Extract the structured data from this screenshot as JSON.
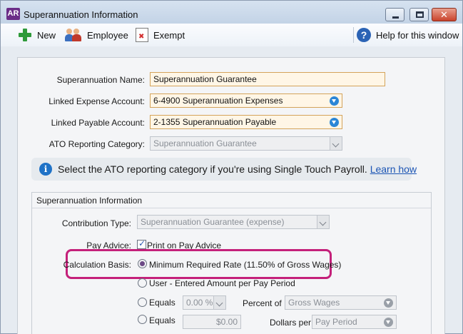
{
  "window": {
    "logo": "AR",
    "title": "Superannuation Information",
    "close_glyph": "✕"
  },
  "toolbar": {
    "new_label": "New",
    "employee_label": "Employee",
    "exempt_label": "Exempt",
    "help_label": "Help for this window",
    "help_glyph": "?"
  },
  "form": {
    "name_label": "Superannuation Name:",
    "name_value": "Superannuation Guarantee",
    "expense_label": "Linked Expense Account:",
    "expense_value": "6-4900 Superannuation Expenses",
    "payable_label": "Linked Payable Account:",
    "payable_value": "2-1355 Superannuation Payable",
    "ato_label": "ATO Reporting Category:",
    "ato_value": "Superannuation Guarantee"
  },
  "info": {
    "icon": "i",
    "text": "Select the ATO reporting category if you're using Single Touch Payroll.",
    "link": "Learn how"
  },
  "super_info": {
    "group_title": "Superannuation Information",
    "contribution_label": "Contribution Type:",
    "contribution_value": "Superannuation Guarantee (expense)",
    "pay_advice_label": "Pay Advice:",
    "pay_advice_option": "Print on Pay Advice",
    "calc_label": "Calculation Basis:",
    "calc_options": {
      "min_rate": "Minimum Required Rate (11.50% of Gross Wages)",
      "user_entered": "User - Entered Amount per Pay Period",
      "equals_pct": "Equals",
      "equals_amt": "Equals"
    },
    "percent_value": "0.00 %",
    "percent_of_label": "Percent of",
    "percent_of_value": "Gross Wages",
    "dollar_value": "$0.00",
    "dollars_per_label": "Dollars per",
    "dollars_per_value": "Pay Period"
  }
}
